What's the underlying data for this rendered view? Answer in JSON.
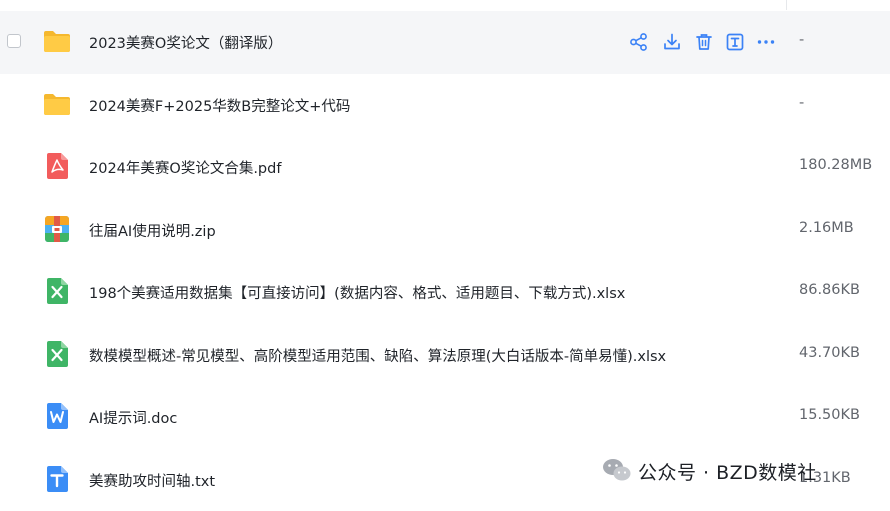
{
  "files": [
    {
      "name": "2023美赛O奖论文（翻译版）",
      "size": "-",
      "type": "folder",
      "hovered": true
    },
    {
      "name": "2024美赛F+2025华数B完整论文+代码",
      "size": "-",
      "type": "folder"
    },
    {
      "name": "2024年美赛O奖论文合集.pdf",
      "size": "180.28MB",
      "type": "pdf"
    },
    {
      "name": "往届AI使用说明.zip",
      "size": "2.16MB",
      "type": "zip"
    },
    {
      "name": "198个美赛适用数据集【可直接访问】(数据内容、格式、适用题目、下载方式).xlsx",
      "size": "86.86KB",
      "type": "xlsx"
    },
    {
      "name": "数模模型概述-常见模型、高阶模型适用范围、缺陷、算法原理(大白话版本-简单易懂).xlsx",
      "size": "43.70KB",
      "type": "xlsx"
    },
    {
      "name": "AI提示词.doc",
      "size": "15.50KB",
      "type": "doc"
    },
    {
      "name": "美赛助攻时间轴.txt",
      "size": "1.31KB",
      "type": "txt"
    }
  ],
  "hover_actions": [
    "share-icon",
    "download-icon",
    "delete-icon",
    "rename-icon",
    "more-icon"
  ],
  "watermark": {
    "text": "公众号 · BZD数模社"
  },
  "colors": {
    "accent": "#3b82f6",
    "folder": "#ffc93c",
    "pdf": "#f25c5c",
    "xlsx": "#3fb566",
    "doc": "#3b8df6",
    "txt": "#3b8df6",
    "hover_row": "#f5f6f8"
  }
}
